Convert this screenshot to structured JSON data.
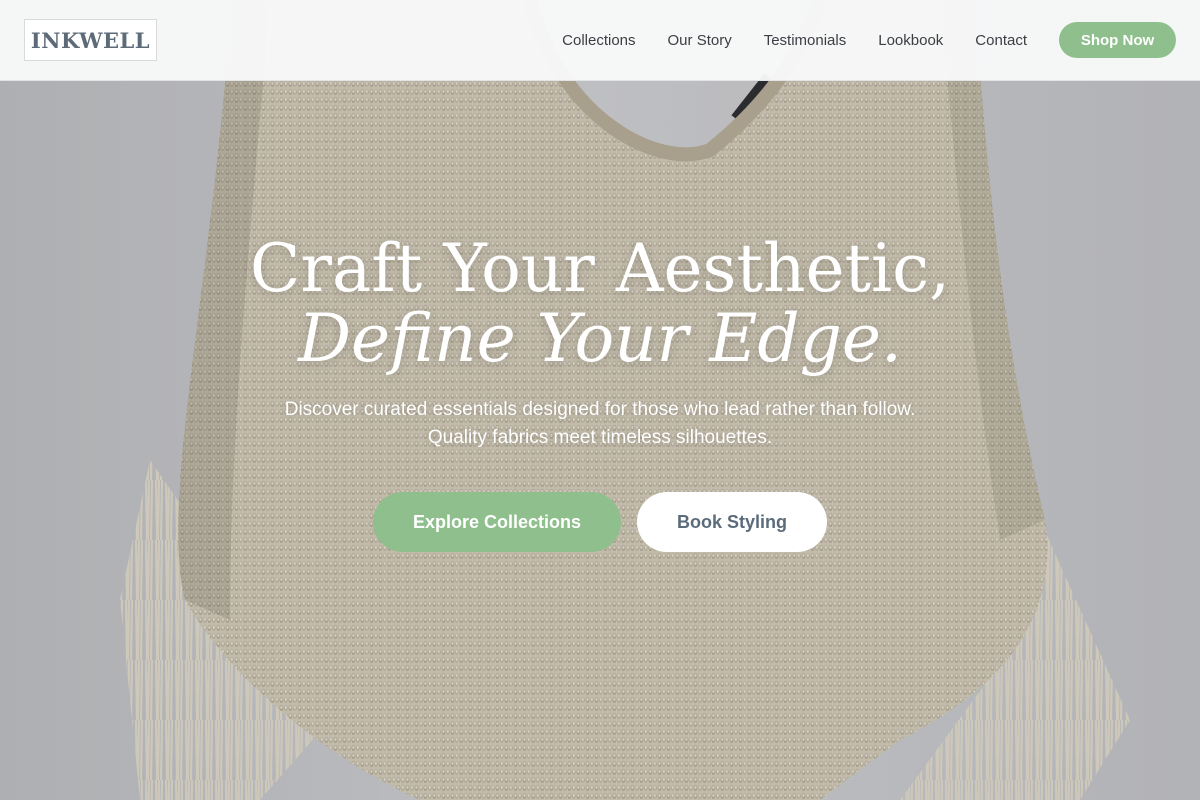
{
  "brand": {
    "logo_text": "INKWELL"
  },
  "nav": {
    "items": [
      {
        "label": "Collections"
      },
      {
        "label": "Our Story"
      },
      {
        "label": "Testimonials"
      },
      {
        "label": "Lookbook"
      },
      {
        "label": "Contact"
      }
    ],
    "cta_label": "Shop Now"
  },
  "hero": {
    "headline_line1": "Craft Your Aesthetic,",
    "headline_line2": "Define Your Edge.",
    "subtext": "Discover curated essentials designed for those who lead rather than follow. Quality fabrics meet timeless silhouettes.",
    "primary_button": "Explore Collections",
    "secondary_button": "Book Styling"
  },
  "colors": {
    "accent_green": "#8fbf8c",
    "logo_slate": "#5d6b78",
    "secondary_button_text": "#5b6b7a",
    "background_wall": "#c9cacc",
    "knit_garment": "#d8d1bd"
  }
}
